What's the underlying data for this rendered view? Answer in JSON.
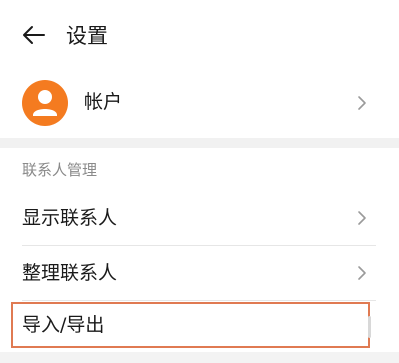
{
  "header": {
    "title": "设置",
    "back_icon": "back-arrow-icon"
  },
  "account": {
    "label": "帐户",
    "avatar_color": "#f47b20",
    "avatar_icon": "person-icon"
  },
  "contacts_section": {
    "header": "联系人管理",
    "items": [
      {
        "label": "显示联系人",
        "has_chevron": true
      },
      {
        "label": "整理联系人",
        "has_chevron": true
      },
      {
        "label": "导入/导出",
        "has_chevron": false,
        "highlighted": true
      }
    ]
  },
  "colors": {
    "highlight_border": "#e07a52",
    "section_header": "#8a8a8a",
    "chevron": "#9a9a9a"
  }
}
